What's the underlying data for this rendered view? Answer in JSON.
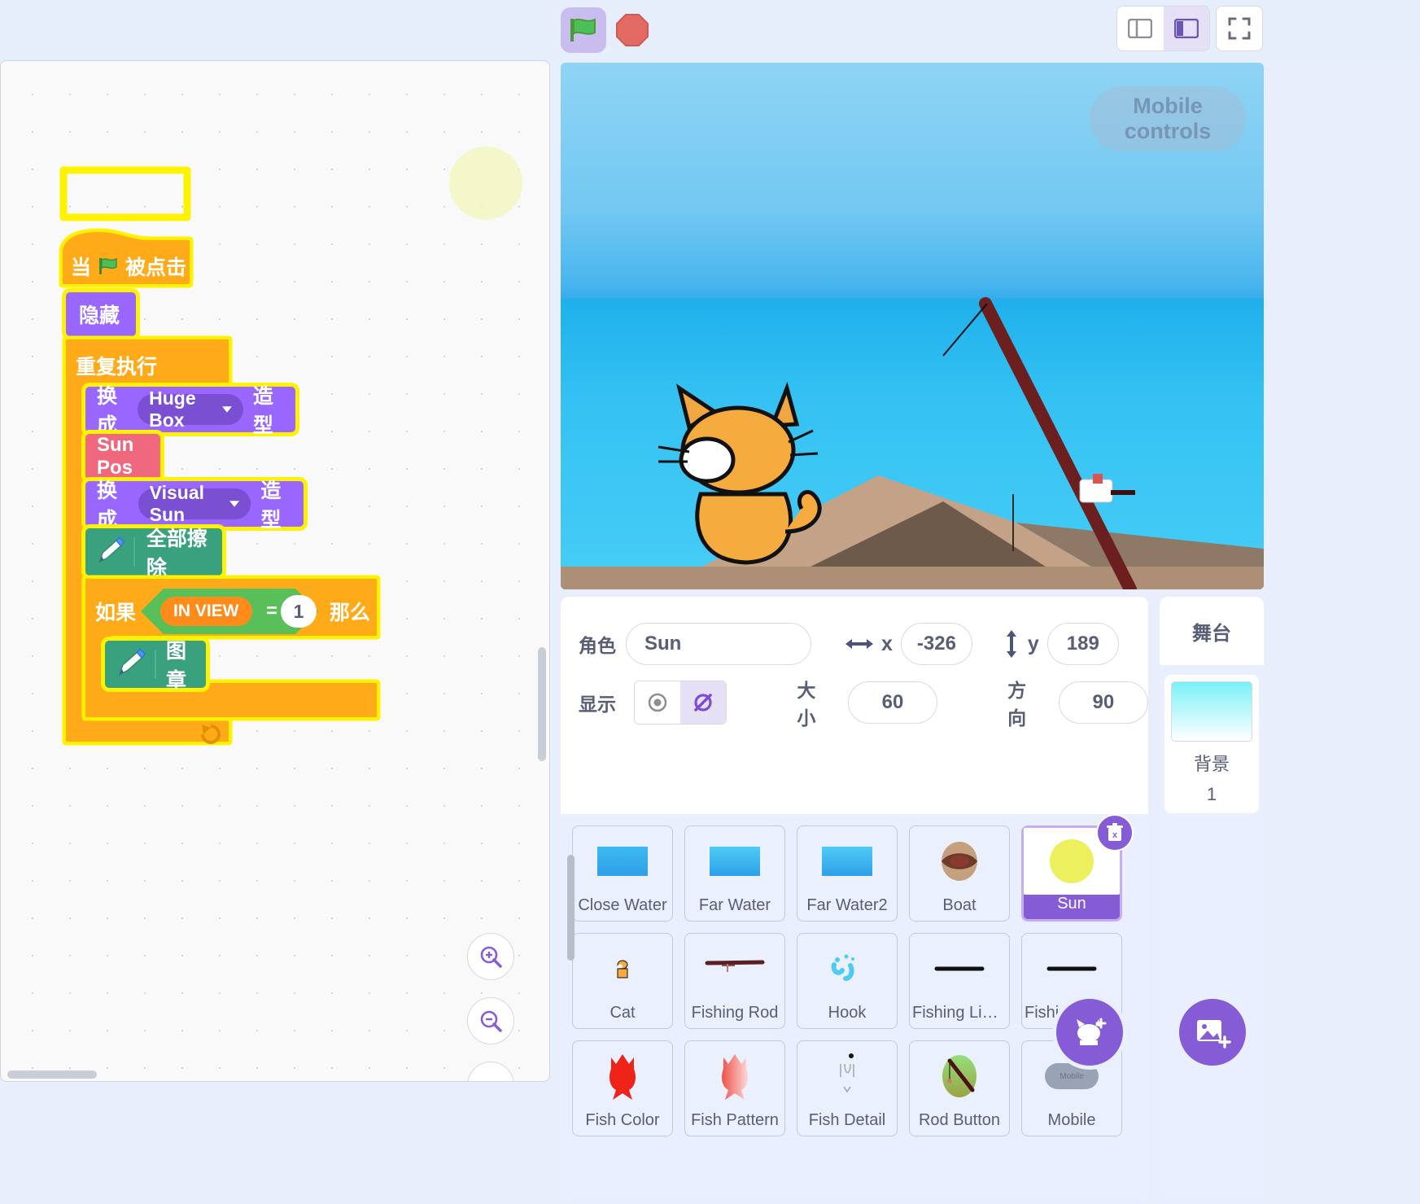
{
  "toolbar": {
    "green_flag": "green-flag-icon",
    "stop": "stop-sign-icon",
    "small_stage_label": "small-stage-icon",
    "large_stage_label": "large-stage-icon",
    "fullscreen_label": "fullscreen-icon"
  },
  "stage": {
    "mobile_controls_label": "Mobile controls"
  },
  "script": {
    "blocks": [
      {
        "id": "when_flag",
        "text_before": "当",
        "icon": "green-flag-icon",
        "text_after": "被点击"
      },
      {
        "id": "hide",
        "text": "隐藏"
      },
      {
        "id": "forever",
        "text": "重复执行"
      },
      {
        "id": "switch_costume_1",
        "prefix": "换成",
        "dropdown": "Huge Box",
        "suffix": "造型"
      },
      {
        "id": "custom_sun_pos",
        "text": "Sun Pos"
      },
      {
        "id": "switch_costume_2",
        "prefix": "换成",
        "dropdown": "Visual Sun",
        "suffix": "造型"
      },
      {
        "id": "pen_erase_all",
        "text": "全部擦除",
        "icon": "pen-icon"
      },
      {
        "id": "if_then",
        "prefix": "如果",
        "operand_left": "IN VIEW",
        "operator": "=",
        "operand_right": "1",
        "suffix": "那么"
      },
      {
        "id": "pen_stamp",
        "text": "图章",
        "icon": "pen-icon"
      }
    ]
  },
  "sprite_info": {
    "name_label": "角色",
    "name_value": "Sun",
    "x_label": "x",
    "x_value": "-326",
    "y_label": "y",
    "y_value": "189",
    "show_label": "显示",
    "size_label": "大小",
    "size_value": "60",
    "direction_label": "方向",
    "direction_value": "90",
    "visible_selected": false
  },
  "sprites": [
    {
      "name": "Close Water",
      "thumb": "water-rect",
      "selected": false
    },
    {
      "name": "Far Water",
      "thumb": "water-rect",
      "selected": false
    },
    {
      "name": "Far Water2",
      "thumb": "water-rect",
      "selected": false
    },
    {
      "name": "Boat",
      "thumb": "boat-icon",
      "selected": false
    },
    {
      "name": "Sun",
      "thumb": "sun-circle",
      "selected": true
    },
    {
      "name": "Cat",
      "thumb": "cat-icon",
      "selected": false
    },
    {
      "name": "Fishing Rod",
      "thumb": "rod-icon",
      "selected": false
    },
    {
      "name": "Hook",
      "thumb": "hook-icon",
      "selected": false
    },
    {
      "name": "Fishing Lin…",
      "thumb": "line-icon",
      "selected": false
    },
    {
      "name": "Fishing Lin…",
      "thumb": "line-icon",
      "selected": false
    },
    {
      "name": "Fish Color",
      "thumb": "fish-red-icon",
      "selected": false
    },
    {
      "name": "Fish Pattern",
      "thumb": "fish-pattern-icon",
      "selected": false
    },
    {
      "name": "Fish Detail",
      "thumb": "fish-detail-icon",
      "selected": false
    },
    {
      "name": "Rod Button",
      "thumb": "rod-button-icon",
      "selected": false
    },
    {
      "name": "Mobile",
      "thumb": "mobile-icon",
      "selected": false
    }
  ],
  "stage_panel": {
    "header": "舞台",
    "backdrop_label": "背景",
    "backdrop_count": "1"
  },
  "zoom_controls": {
    "zoom_in": "zoom-in-icon",
    "zoom_out": "zoom-out-icon",
    "zoom_reset": "zoom-reset-icon"
  },
  "colors": {
    "accent_purple": "#855cd6",
    "events_orange": "#ffab19",
    "control_orange": "#ffab19",
    "looks_purple": "#9966ff",
    "pen_green": "#0fbd8c",
    "custom_pink": "#ff6680",
    "operators_green": "#59c059",
    "variable_orange": "#ff8c1a",
    "glow": "#fff200"
  }
}
